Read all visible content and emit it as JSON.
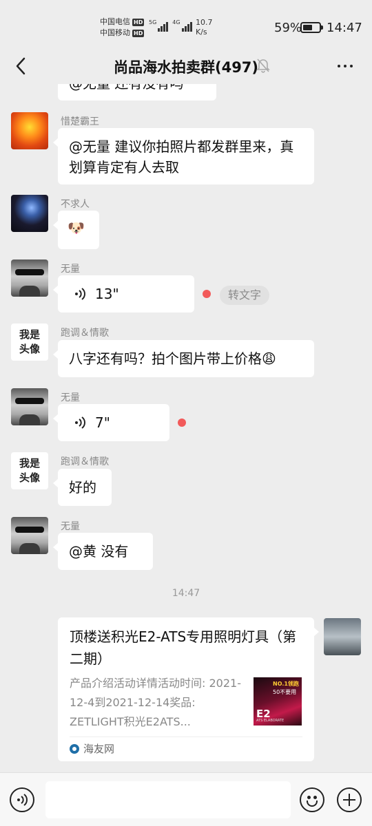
{
  "status_bar": {
    "carrier1": "中国电信",
    "carrier2": "中国移动",
    "hd": "HD",
    "net1": "5G",
    "net2": "4G",
    "speed_value": "10.7",
    "speed_unit": "K/s",
    "battery": "59%",
    "battery_level": 0.59,
    "time": "14:47"
  },
  "header": {
    "title": "尚品海水拍卖群(497)",
    "back_icon": "chevron-left-icon",
    "mute_icon": "bell-off-icon",
    "more_icon": "more-horizontal-icon"
  },
  "messages": [
    {
      "text": "@无量 还有没有吗"
    },
    {
      "sender": "惜楚霸王",
      "text": "@无量  建议你拍照片都发群里来，真划算肯定有人去取"
    },
    {
      "sender": "不求人",
      "text": "🐶"
    },
    {
      "sender": "无量",
      "voice": "13\"",
      "action": "转文字"
    },
    {
      "sender": "跑调＆情歌",
      "avatar_text": "我是头像",
      "text": "八字还有吗？拍个图片带上价格😩"
    },
    {
      "sender": "无量",
      "voice": "7\""
    },
    {
      "sender": "跑调＆情歌",
      "avatar_text": "我是头像",
      "text": "好的"
    },
    {
      "sender": "无量",
      "text": "@黄  没有"
    }
  ],
  "timestamp": "14:47",
  "card": {
    "title": "顶楼送积光E2-ATS专用照明灯具（第二期）",
    "desc": "产品介绍活动详情活动时间: 2021-12-4到2021-12-14奖品: ZETLIGHT积光E2ATS...",
    "thumb_badge": "NO.1领跑",
    "thumb_sub": "50不要用",
    "thumb_model": "E2",
    "thumb_small": "ATS ELABORATE",
    "source": "海友网"
  },
  "input_bar": {
    "voice_icon": "voice-icon",
    "emoji_icon": "emoji-icon",
    "plus_icon": "plus-icon",
    "input_value": ""
  },
  "colors": {
    "background": "#ededed",
    "bubble": "#ffffff",
    "unread_dot": "#f25a5a",
    "source_icon": "#1f6fa8"
  }
}
